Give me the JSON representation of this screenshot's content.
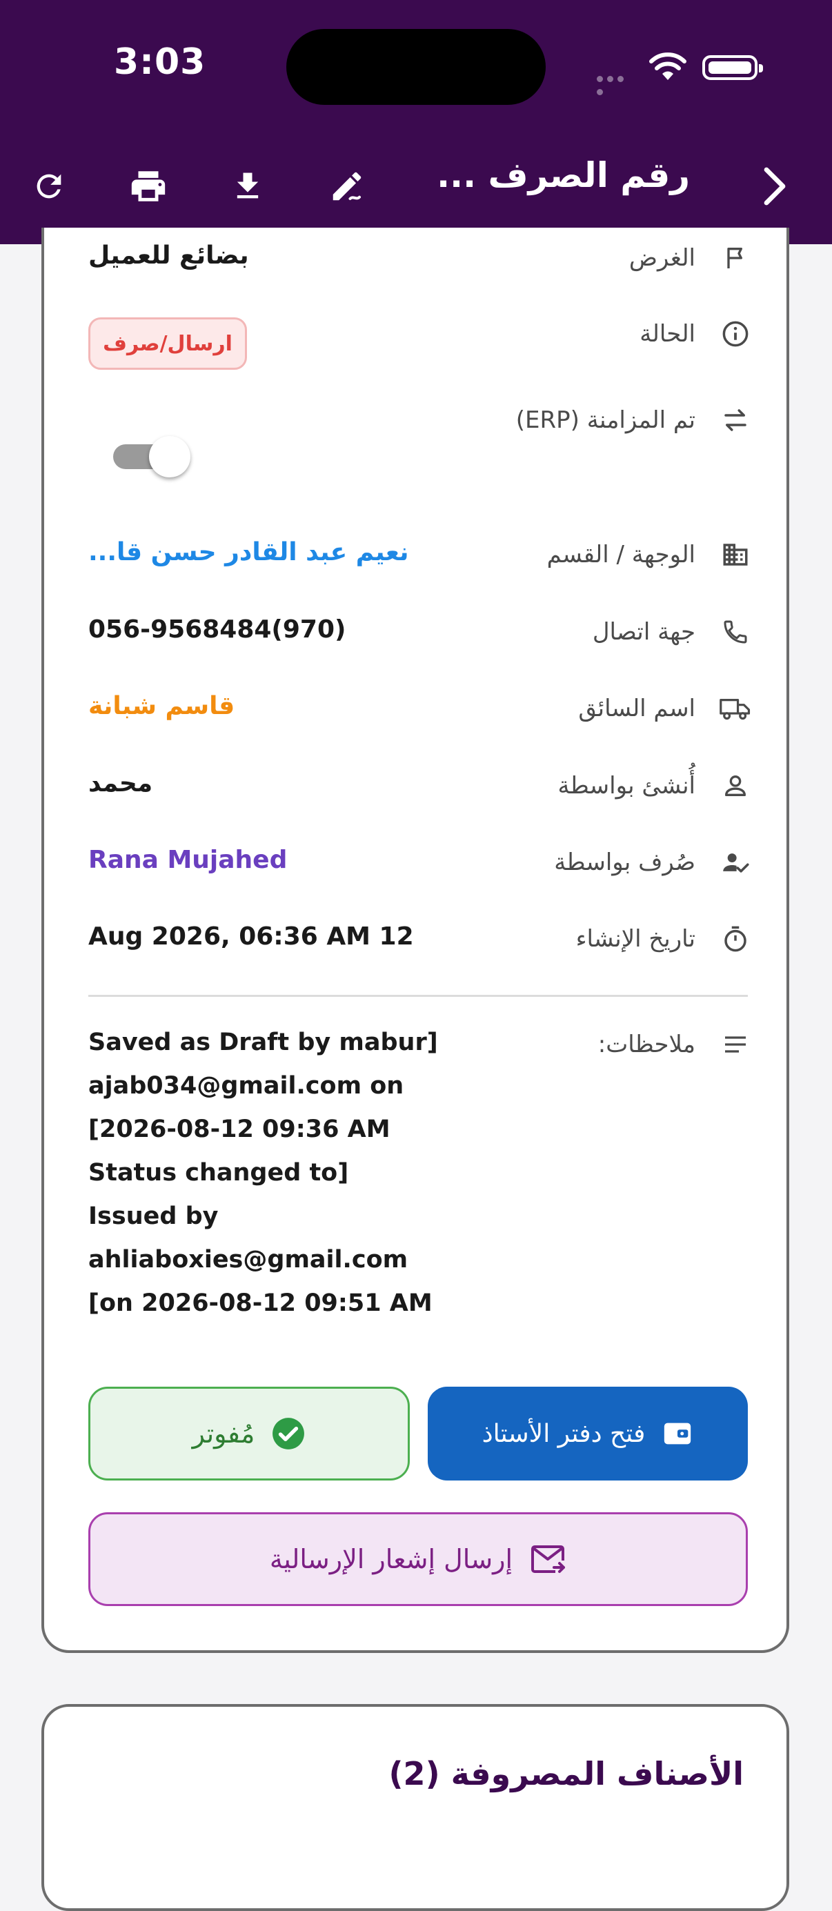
{
  "status_bar": {
    "time": "3:03"
  },
  "header": {
    "title": "رقم الصرف ..."
  },
  "details": {
    "purpose": {
      "label": "الغرض",
      "value": "بضائع للعميل"
    },
    "status": {
      "label": "الحالة",
      "badge": "ارسال/صرف"
    },
    "erp_sync": {
      "label": "تم المزامنة (ERP)",
      "enabled": false
    },
    "destination": {
      "label": "الوجهة / القسم",
      "value": "نعيم عبد القادر حسن قا..."
    },
    "contact": {
      "label": "جهة اتصال",
      "value": "056-9568484(970)"
    },
    "driver": {
      "label": "اسم السائق",
      "value": "قاسم شبانة"
    },
    "created_by": {
      "label": "أُنشئ بواسطة",
      "value": "محمد"
    },
    "issued_by": {
      "label": "صُرف بواسطة",
      "value": "Rana Mujahed"
    },
    "created_at": {
      "label": "تاريخ الإنشاء",
      "value": "Aug 2026, 06:36 AM 12"
    },
    "notes": {
      "label": "ملاحظات:",
      "text": "Saved as Draft by mabur]\najab034@gmail.com on\n[2026-08-12 09:36 AM\nStatus changed to]\nIssued by\nahliaboxies@gmail.com\n[on 2026-08-12 09:51 AM"
    }
  },
  "actions": {
    "open_ledger": "فتح دفتر الأستاذ",
    "invoiced": "مُفوتر",
    "send_notice": "إرسال إشعار الإرسالية"
  },
  "items_section": {
    "title": "الأصناف المصروفة (2)"
  },
  "colors": {
    "header_bg": "#3b0a4f",
    "destination": "#1e88e5",
    "driver": "#f28c0f",
    "issued_by": "#6a3fbf",
    "ledger_btn": "#1565c0"
  }
}
